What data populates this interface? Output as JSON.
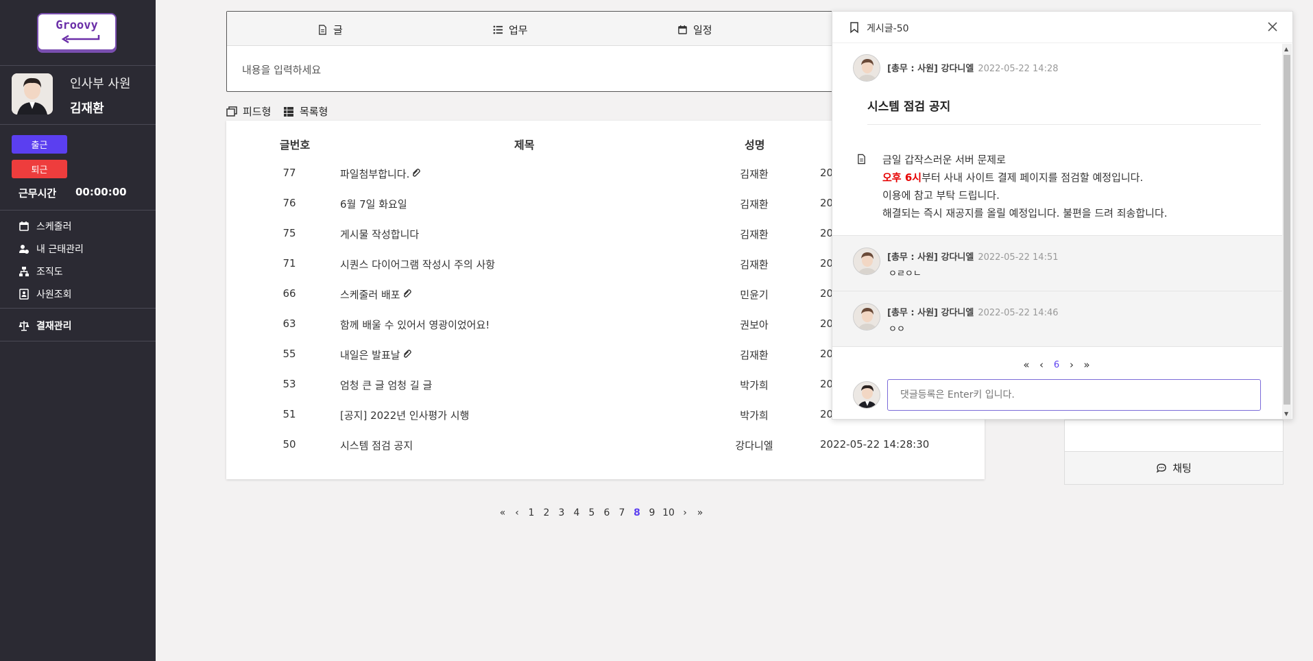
{
  "sidebar": {
    "logo": "Groovy",
    "profile_role": "인사부 사원",
    "profile_name": "김재환",
    "checkin": "출근",
    "checkout": "퇴근",
    "worktime_label": "근무시간",
    "worktime_value": "00:00:00",
    "menu": [
      "스케줄러",
      "내 근태관리",
      "조직도",
      "사원조회"
    ],
    "approval": "결재관리"
  },
  "composer": {
    "tabs": [
      "글",
      "업무",
      "일정"
    ],
    "placeholder": "내용을 입력하세요"
  },
  "view_toggle": {
    "feed": "피드형",
    "list": "목록형"
  },
  "table": {
    "headers": [
      "글번호",
      "제목",
      "성명"
    ],
    "rows": [
      {
        "no": "77",
        "title": "파일첨부합니다.",
        "clip": true,
        "name": "김재환",
        "date": "20"
      },
      {
        "no": "76",
        "title": "6월 7일 화요일",
        "clip": false,
        "name": "김재환",
        "date": "20"
      },
      {
        "no": "75",
        "title": "게시물 작성합니다",
        "clip": false,
        "name": "김재환",
        "date": "20"
      },
      {
        "no": "71",
        "title": "시퀀스 다이어그램 작성시 주의 사항",
        "clip": false,
        "name": "김재환",
        "date": "20"
      },
      {
        "no": "66",
        "title": "스케줄러 배포",
        "clip": true,
        "name": "민윤기",
        "date": "20"
      },
      {
        "no": "63",
        "title": "함께 배울 수 있어서 영광이었어요!",
        "clip": false,
        "name": "권보아",
        "date": "20"
      },
      {
        "no": "55",
        "title": "내일은 발표날",
        "clip": true,
        "name": "김재환",
        "date": "20"
      },
      {
        "no": "53",
        "title": "엄청 큰 글 엄청 길 글",
        "clip": false,
        "name": "박가희",
        "date": "20"
      },
      {
        "no": "51",
        "title": "[공지] 2022년 인사평가 시행",
        "clip": false,
        "name": "박가희",
        "date": "20"
      },
      {
        "no": "50",
        "title": "시스템 점검 공지",
        "clip": false,
        "name": "강다니엘",
        "date": "2022-05-22 14:28:30"
      }
    ]
  },
  "pagination": {
    "pages": [
      "1",
      "2",
      "3",
      "4",
      "5",
      "6",
      "7",
      "8",
      "9",
      "10"
    ],
    "current": "8"
  },
  "modal": {
    "title": "게시글-50",
    "author": "[총무 : 사원] 강다니엘",
    "date": "2022-05-22 14:28",
    "post_title": "시스템 점검 공지",
    "body_line1": "금일 갑작스러운 서버 문제로",
    "body_red": "오후 6시",
    "body_line2": "부터 사내 사이트 결제 페이지를 점검할 예정입니다.",
    "body_line3": "이용에 참고 부탁 드립니다.",
    "body_line4": "해결되는 즉시 재공지를 올릴 예정입니다. 불편을 드려 죄송합니다.",
    "comments": [
      {
        "author": "[총무 : 사원] 강다니엘",
        "date": "2022-05-22 14:51",
        "text": "ㅇㄹㅇㄴ"
      },
      {
        "author": "[총무 : 사원] 강다니엘",
        "date": "2022-05-22 14:46",
        "text": "ㅇㅇ"
      }
    ],
    "comment_page": "6",
    "comment_placeholder": "댓글등록은 Enter키 입니다."
  },
  "chat": {
    "label": "채팅"
  },
  "colors": {
    "sidebar": "#2b2a33",
    "checkin": "#5b3ff0",
    "checkout": "#ee3d3d",
    "accent": "#5b3ff0",
    "red": "#e60000"
  }
}
